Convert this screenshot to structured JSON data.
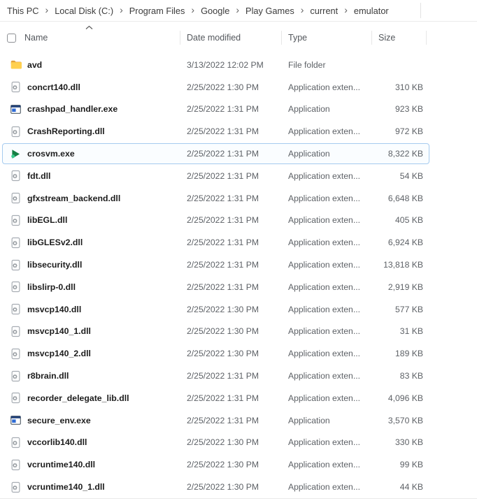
{
  "breadcrumb": {
    "items": [
      "This PC",
      "Local Disk (C:)",
      "Program Files",
      "Google",
      "Play Games",
      "current",
      "emulator"
    ],
    "separator": "›"
  },
  "columns": {
    "name": "Name",
    "date_modified": "Date modified",
    "type": "Type",
    "size": "Size"
  },
  "sort": {
    "column": "Name",
    "direction": "ascending"
  },
  "colors": {
    "selection_border": "#a6cbef",
    "folder_yellow": "#ffd04f",
    "folder_flap": "#e3a23a",
    "exe_blue": "#2e6bd6",
    "exe_titlebar": "#1f3f77",
    "crosvm_green_dark": "#157f43",
    "crosvm_green_light": "#3acb8e",
    "header_text": "#53575c",
    "secondary_text": "#5d6166",
    "name_text": "#1d1d1d"
  },
  "files": [
    {
      "name": "avd",
      "icon": "folder",
      "date": "3/13/2022 12:02 PM",
      "type": "File folder",
      "size": "",
      "selected": false
    },
    {
      "name": "concrt140.dll",
      "icon": "dll",
      "date": "2/25/2022 1:30 PM",
      "type": "Application exten...",
      "size": "310 KB",
      "selected": false
    },
    {
      "name": "crashpad_handler.exe",
      "icon": "exe",
      "date": "2/25/2022 1:31 PM",
      "type": "Application",
      "size": "923 KB",
      "selected": false
    },
    {
      "name": "CrashReporting.dll",
      "icon": "dll",
      "date": "2/25/2022 1:31 PM",
      "type": "Application exten...",
      "size": "972 KB",
      "selected": false
    },
    {
      "name": "crosvm.exe",
      "icon": "crosvm",
      "date": "2/25/2022 1:31 PM",
      "type": "Application",
      "size": "8,322 KB",
      "selected": true
    },
    {
      "name": "fdt.dll",
      "icon": "dll",
      "date": "2/25/2022 1:31 PM",
      "type": "Application exten...",
      "size": "54 KB",
      "selected": false
    },
    {
      "name": "gfxstream_backend.dll",
      "icon": "dll",
      "date": "2/25/2022 1:31 PM",
      "type": "Application exten...",
      "size": "6,648 KB",
      "selected": false
    },
    {
      "name": "libEGL.dll",
      "icon": "dll",
      "date": "2/25/2022 1:31 PM",
      "type": "Application exten...",
      "size": "405 KB",
      "selected": false
    },
    {
      "name": "libGLESv2.dll",
      "icon": "dll",
      "date": "2/25/2022 1:31 PM",
      "type": "Application exten...",
      "size": "6,924 KB",
      "selected": false
    },
    {
      "name": "libsecurity.dll",
      "icon": "dll",
      "date": "2/25/2022 1:31 PM",
      "type": "Application exten...",
      "size": "13,818 KB",
      "selected": false
    },
    {
      "name": "libslirp-0.dll",
      "icon": "dll",
      "date": "2/25/2022 1:31 PM",
      "type": "Application exten...",
      "size": "2,919 KB",
      "selected": false
    },
    {
      "name": "msvcp140.dll",
      "icon": "dll",
      "date": "2/25/2022 1:30 PM",
      "type": "Application exten...",
      "size": "577 KB",
      "selected": false
    },
    {
      "name": "msvcp140_1.dll",
      "icon": "dll",
      "date": "2/25/2022 1:30 PM",
      "type": "Application exten...",
      "size": "31 KB",
      "selected": false
    },
    {
      "name": "msvcp140_2.dll",
      "icon": "dll",
      "date": "2/25/2022 1:30 PM",
      "type": "Application exten...",
      "size": "189 KB",
      "selected": false
    },
    {
      "name": "r8brain.dll",
      "icon": "dll",
      "date": "2/25/2022 1:31 PM",
      "type": "Application exten...",
      "size": "83 KB",
      "selected": false
    },
    {
      "name": "recorder_delegate_lib.dll",
      "icon": "dll",
      "date": "2/25/2022 1:31 PM",
      "type": "Application exten...",
      "size": "4,096 KB",
      "selected": false
    },
    {
      "name": "secure_env.exe",
      "icon": "exe",
      "date": "2/25/2022 1:31 PM",
      "type": "Application",
      "size": "3,570 KB",
      "selected": false
    },
    {
      "name": "vccorlib140.dll",
      "icon": "dll",
      "date": "2/25/2022 1:30 PM",
      "type": "Application exten...",
      "size": "330 KB",
      "selected": false
    },
    {
      "name": "vcruntime140.dll",
      "icon": "dll",
      "date": "2/25/2022 1:30 PM",
      "type": "Application exten...",
      "size": "99 KB",
      "selected": false
    },
    {
      "name": "vcruntime140_1.dll",
      "icon": "dll",
      "date": "2/25/2022 1:30 PM",
      "type": "Application exten...",
      "size": "44 KB",
      "selected": false
    }
  ]
}
